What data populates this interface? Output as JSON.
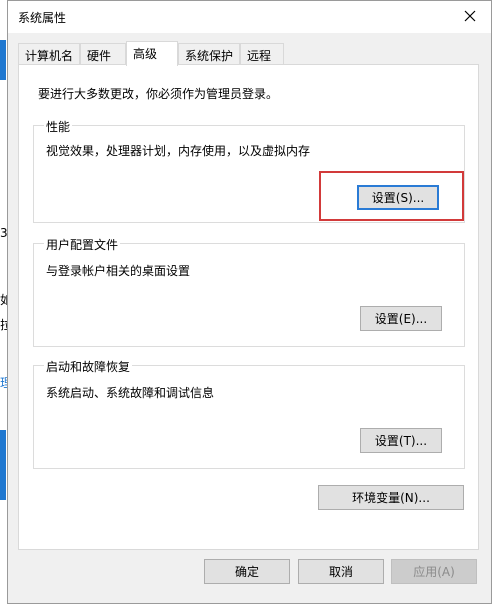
{
  "background": {
    "fragments": [
      "3",
      "如",
      "拉",
      "理"
    ]
  },
  "dialog": {
    "title": "系统属性",
    "close_icon": "close-icon",
    "tabs": [
      {
        "label": "计算机名",
        "active": false
      },
      {
        "label": "硬件",
        "active": false
      },
      {
        "label": "高级",
        "active": true
      },
      {
        "label": "系统保护",
        "active": false
      },
      {
        "label": "远程",
        "active": false
      }
    ],
    "notice": "要进行大多数更改，你必须作为管理员登录。",
    "groups": {
      "performance": {
        "title": "性能",
        "desc": "视觉效果，处理器计划，内存使用，以及虚拟内存",
        "button": "设置(S)..."
      },
      "profile": {
        "title": "用户配置文件",
        "desc": "与登录帐户相关的桌面设置",
        "button": "设置(E)..."
      },
      "startup": {
        "title": "启动和故障恢复",
        "desc": "系统启动、系统故障和调试信息",
        "button": "设置(T)..."
      }
    },
    "env_button": "环境变量(N)...",
    "footer": {
      "ok": "确定",
      "cancel": "取消",
      "apply": "应用(A)"
    }
  },
  "colors": {
    "highlight": "#d23a3a",
    "focus": "#2a7bd5",
    "accent": "#1e77d0"
  }
}
